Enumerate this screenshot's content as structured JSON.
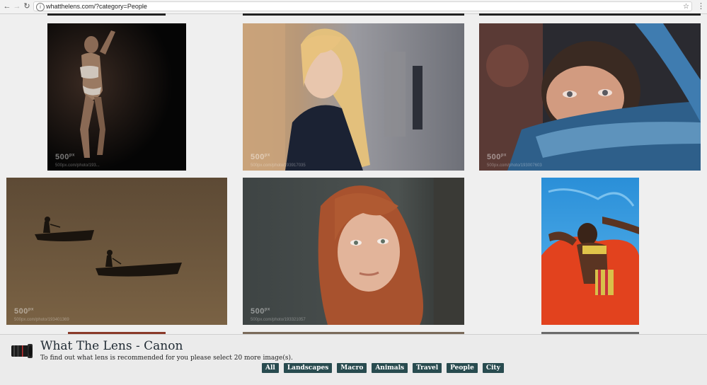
{
  "browser": {
    "url": "whatthelens.com/?category=People",
    "back_icon": "←",
    "forward_icon": "→",
    "reload_icon": "↻",
    "info_icon": "i",
    "star_icon": "☆",
    "menu_icon": "⋮"
  },
  "photos": [
    {
      "name": "photo-woman-lingerie-dark",
      "watermark": "500",
      "sup": "px",
      "sub": "500px.com/photo/193..."
    },
    {
      "name": "photo-blonde-woman-street",
      "watermark": "500",
      "sup": "px",
      "sub": "500px.com/photo/193917035"
    },
    {
      "name": "photo-woman-veiled-eyes",
      "watermark": "500",
      "sup": "px",
      "sub": "500px.com/photo/193007603"
    },
    {
      "name": "photo-boats-on-water",
      "watermark": "500",
      "sup": "px",
      "sub": "500px.com/photo/193401369"
    },
    {
      "name": "photo-redhead-freckles",
      "watermark": "500",
      "sup": "px",
      "sub": "500px.com/photo/193321057"
    },
    {
      "name": "photo-woman-pool-float",
      "watermark": "",
      "sup": "",
      "sub": ""
    }
  ],
  "panel": {
    "title": "What The Lens - Canon",
    "subtitle": "To find out what lens is recommended for you please select 20 more image(s).",
    "categories": [
      "All",
      "Landscapes",
      "Macro",
      "Animals",
      "Travel",
      "People",
      "City"
    ]
  },
  "colors": {
    "button_bg": "#284b4f",
    "page_bg": "#efefef"
  }
}
